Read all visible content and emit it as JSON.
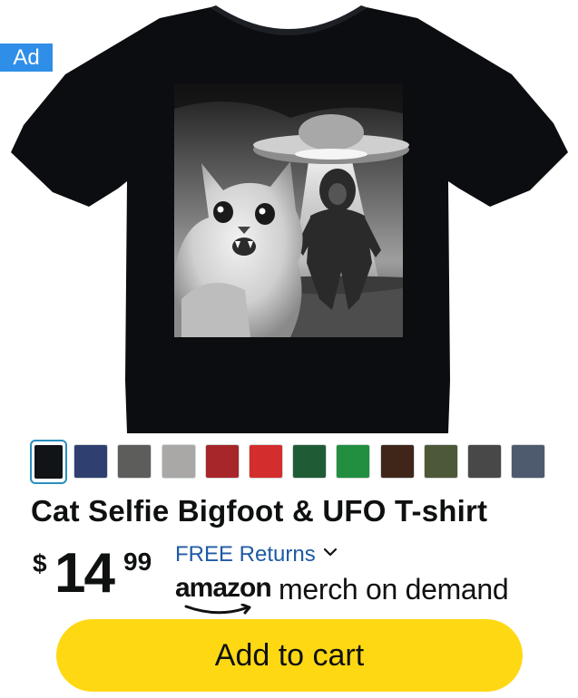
{
  "ad_label": "Ad",
  "product": {
    "title": "Cat Selfie Bigfoot & UFO T-shirt",
    "price": {
      "symbol": "$",
      "whole": "14",
      "fraction": "99"
    },
    "returns_label": "FREE Returns",
    "brand": {
      "logo_text": "amazon",
      "suffix": "merch on demand"
    }
  },
  "swatches": [
    {
      "name": "Black",
      "color": "#111416",
      "selected": true
    },
    {
      "name": "Navy",
      "color": "#2f4070"
    },
    {
      "name": "Dark Heather",
      "color": "#5d5d5b"
    },
    {
      "name": "Heather Grey",
      "color": "#a9a8a6"
    },
    {
      "name": "Cranberry",
      "color": "#a6262a"
    },
    {
      "name": "Red",
      "color": "#d42d2d"
    },
    {
      "name": "Kelly Green",
      "color": "#1f5c36"
    },
    {
      "name": "Green",
      "color": "#218f3f"
    },
    {
      "name": "Brown",
      "color": "#402619"
    },
    {
      "name": "Olive",
      "color": "#4c5838"
    },
    {
      "name": "Charcoal",
      "color": "#484849"
    },
    {
      "name": "Slate",
      "color": "#4e5a6e"
    }
  ],
  "cart_button_label": "Add to cart",
  "colors": {
    "accent": "#ffd814",
    "link": "#1f5aa5",
    "ad_badge": "#2f8fe8",
    "selected_border": "#2a8fbd"
  }
}
